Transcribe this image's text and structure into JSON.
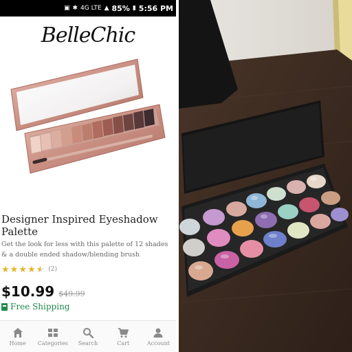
{
  "status_bar": {
    "battery": "85%",
    "time": "5:56 PM",
    "network": "4G LTE"
  },
  "brand": {
    "name": "BelleChic"
  },
  "product": {
    "title": "Designer Inspired Eyeshadow Palette",
    "description": "Get the look for less with this palette of 12 shades & a double ended shadow/blending brush",
    "rating": 4.5,
    "review_count": "(2)",
    "price": "$10.99",
    "old_price": "$49.99",
    "shipping": "Free Shipping"
  },
  "nav": {
    "items": [
      {
        "label": "Home",
        "icon": "home-icon"
      },
      {
        "label": "Categories",
        "icon": "grid-icon"
      },
      {
        "label": "Search",
        "icon": "search-icon"
      },
      {
        "label": "Cart",
        "icon": "cart-icon"
      },
      {
        "label": "Account",
        "icon": "user-icon"
      }
    ]
  },
  "colors": {
    "accent_green": "#1f8a4c",
    "star_gold": "#e6b32a",
    "nav_icon": "#8a8a8a"
  }
}
